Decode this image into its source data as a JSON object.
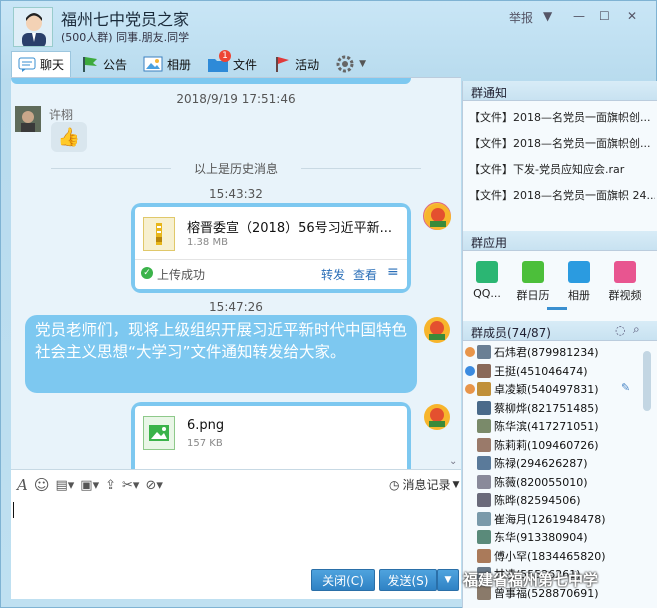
{
  "header": {
    "title": "福州七中党员之家",
    "subtitle": "(500人群) 同事.朋友.同学",
    "report": "举报"
  },
  "toolbar": {
    "chat": "聊天",
    "notice": "公告",
    "album": "相册",
    "file": "文件",
    "file_badge": "1",
    "activity": "活动"
  },
  "chat": {
    "ts1": "2018/9/19 17:51:46",
    "sender": "许栩",
    "history": "以上是历史消息",
    "ts2": "15:43:32",
    "file1": {
      "name": "榕晋委宣（2018）56号习近平新...",
      "size": "1.38 MB",
      "status": "上传成功",
      "forward": "转发",
      "view": "查看"
    },
    "ts3": "15:47:26",
    "message": "党员老师们，现将上级组织开展习近平新时代中国特色社会主义思想“大学习”文件通知转发给大家。",
    "file2": {
      "name": "6.png",
      "size": "157 KB"
    }
  },
  "input": {
    "history_label": "消息记录",
    "close": "关闭(C)",
    "send": "发送(S)"
  },
  "side": {
    "notice_title": "群通知",
    "notices": [
      "【文件】2018—名党员一面旗帜创...",
      "【文件】2018—名党员一面旗帜创...",
      "【文件】下发-党员应知应会.rar",
      "【文件】2018—名党员一面旗帜 24..."
    ],
    "apps_title": "群应用",
    "apps": [
      {
        "label": "QQ...",
        "color": "#2bb673"
      },
      {
        "label": "群日历",
        "color": "#4cbf3a"
      },
      {
        "label": "相册",
        "color": "#2b9be0"
      },
      {
        "label": "群视频",
        "color": "#e85590"
      }
    ],
    "members_title": "群成员(74/87)",
    "members": [
      "石炜君(879981234)",
      "王挺(451046474)",
      "卓凌颖(540497831)",
      "蔡柳烨(821751485)",
      "陈华滨(417271051)",
      "陈莉莉(109460726)",
      "陈禄(294626287)",
      "陈薇(820055010)",
      "陈晔(82594506)",
      "崔海月(1261948478)",
      "东华(913380904)",
      "傅小罕(1834465820)",
      "甘凌(55526261)",
      "曾事福(528870691)"
    ]
  },
  "watermark": "福建省福州第七中学"
}
